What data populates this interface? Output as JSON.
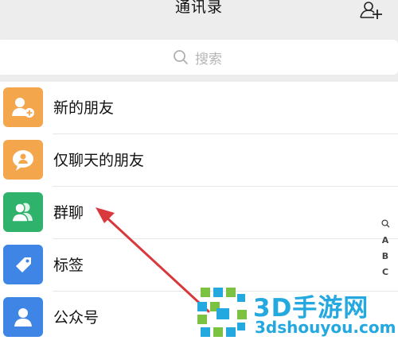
{
  "header": {
    "title": "通讯录",
    "add_contact_icon": "add-contact-icon"
  },
  "search": {
    "placeholder": "搜索",
    "icon": "search-icon"
  },
  "colors": {
    "orange": "#f3a64b",
    "green": "#2fb36c",
    "blue": "#3f85e5",
    "arrow": "#d9383c",
    "watermark": "#23a8e0"
  },
  "items": [
    {
      "label": "新的朋友",
      "icon": "new-friend-icon"
    },
    {
      "label": "仅聊天的朋友",
      "icon": "chat-only-friends-icon"
    },
    {
      "label": "群聊",
      "icon": "group-chat-icon"
    },
    {
      "label": "标签",
      "icon": "tag-icon"
    },
    {
      "label": "公众号",
      "icon": "official-account-icon"
    }
  ],
  "index_bar": {
    "letters": [
      "A",
      "B",
      "C"
    ],
    "search_icon": "index-search-icon"
  },
  "watermark": {
    "brand": "3D手游网",
    "domain": "3dshouyou.com"
  }
}
